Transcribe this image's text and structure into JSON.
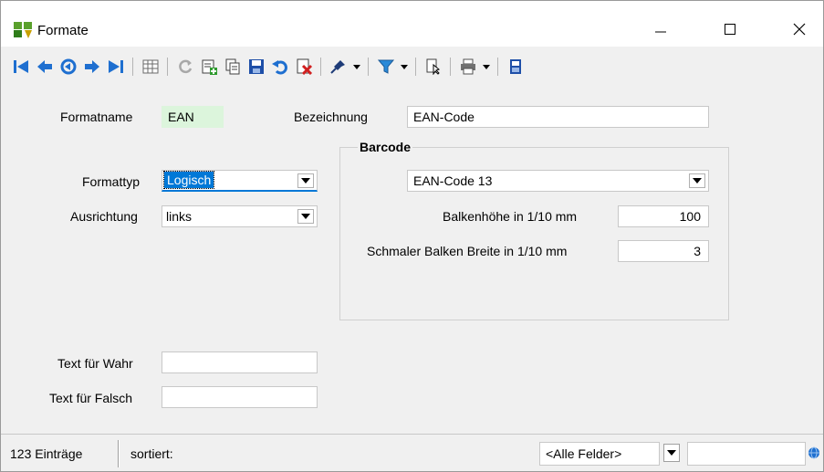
{
  "window": {
    "title": "Formate",
    "minimize_label": "minimize",
    "maximize_label": "maximize",
    "close_label": "close"
  },
  "toolbar": {
    "buttons": [
      {
        "name": "first-record",
        "icon": "skip-first-icon"
      },
      {
        "name": "previous-record",
        "icon": "arrow-left-icon"
      },
      {
        "name": "goto-record",
        "icon": "goto-icon"
      },
      {
        "name": "next-record",
        "icon": "arrow-right-icon"
      },
      {
        "name": "last-record",
        "icon": "skip-last-icon"
      },
      {
        "name": "table-view",
        "icon": "table-icon"
      },
      {
        "name": "refresh",
        "icon": "refresh-icon"
      },
      {
        "name": "new-record",
        "icon": "new-icon"
      },
      {
        "name": "copy-record",
        "icon": "copy-icon"
      },
      {
        "name": "save-record",
        "icon": "save-icon"
      },
      {
        "name": "undo",
        "icon": "undo-icon"
      },
      {
        "name": "delete-record",
        "icon": "delete-icon"
      },
      {
        "name": "pin",
        "icon": "pin-icon"
      },
      {
        "name": "filter",
        "icon": "filter-icon"
      },
      {
        "name": "select-columns",
        "icon": "cursor-doc-icon"
      },
      {
        "name": "print",
        "icon": "print-icon"
      },
      {
        "name": "export",
        "icon": "device-icon"
      }
    ]
  },
  "form": {
    "formatname_label": "Formatname",
    "formatname_value": "EAN",
    "bezeichnung_label": "Bezeichnung",
    "bezeichnung_value": "EAN-Code",
    "formattyp_label": "Formattyp",
    "formattyp_value": "Logisch",
    "ausrichtung_label": "Ausrichtung",
    "ausrichtung_value": "links",
    "text_wahr_label": "Text für Wahr",
    "text_wahr_value": "",
    "text_falsch_label": "Text für Falsch",
    "text_falsch_value": "",
    "barcode": {
      "title": "Barcode",
      "type_value": "EAN-Code 13",
      "balkenhoehe_label": "Balkenhöhe in 1/10 mm",
      "balkenhoehe_value": "100",
      "schmal_label": "Schmaler Balken Breite in 1/10 mm",
      "schmal_value": "3"
    }
  },
  "statusbar": {
    "count": "123 Einträge",
    "sorted": "sortiert:",
    "field_filter": "<Alle Felder>",
    "search_value": ""
  },
  "colors": {
    "accent": "#0078d7",
    "green_field": "#dcf5dc"
  }
}
